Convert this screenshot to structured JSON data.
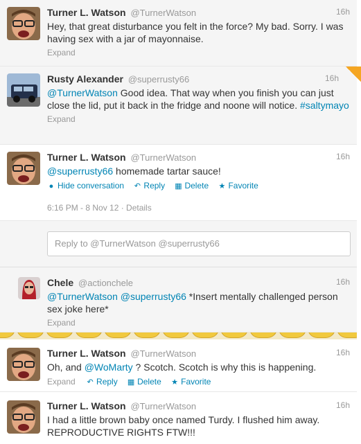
{
  "tweets": [
    {
      "name": "Turner L. Watson",
      "handle": "@TurnerWatson",
      "time": "16h",
      "text": "Hey, that great disturbance you felt in the force? My bad. Sorry. I was having sex with a jar of mayonnaise.",
      "expand": "Expand"
    },
    {
      "name": "Rusty Alexander",
      "handle": "@superrusty66",
      "time": "16h",
      "mention": "@TurnerWatson",
      "text": " Good idea. That way when you finish you can just close the lid, put it back in the fridge and noone will notice. ",
      "hashtag": "#saltymayo",
      "expand": "Expand"
    },
    {
      "name": "Turner L. Watson",
      "handle": "@TurnerWatson",
      "time": "16h",
      "mention": "@superrusty66",
      "text": " homemade tartar sauce!",
      "actions": {
        "hide": "Hide conversation",
        "reply": "Reply",
        "delete": "Delete",
        "favorite": "Favorite"
      },
      "meta": "6:16 PM - 8 Nov 12 · Details"
    },
    {
      "name": "Chele",
      "handle": "@actionchele",
      "time": "16h",
      "mention1": "@TurnerWatson",
      "mention2": "@superrusty66",
      "text": " *Insert mentally challenged person sex joke here*",
      "expand": "Expand"
    },
    {
      "name": "Turner L. Watson",
      "handle": "@TurnerWatson",
      "time": "16h",
      "text_before": "Oh, and ",
      "mention": "@WoMarty",
      "text_after": " ? Scotch. Scotch is why this is happening.",
      "actions": {
        "expand": "Expand",
        "reply": "Reply",
        "delete": "Delete",
        "favorite": "Favorite"
      }
    },
    {
      "name": "Turner L. Watson",
      "handle": "@TurnerWatson",
      "time": "16h",
      "text": "I had a little brown baby once named Turdy. I flushed him away. REPRODUCTIVE RIGHTS FTW!!!"
    }
  ],
  "reply_box": {
    "placeholder": "Reply to @TurnerWatson @superrusty66"
  },
  "icons": {
    "hide": "speech-bubble-icon",
    "reply": "reply-arrow-icon",
    "delete": "trash-icon",
    "favorite": "star-icon"
  },
  "colors": {
    "link": "#0084b4",
    "muted": "#999999",
    "name": "#333333"
  }
}
